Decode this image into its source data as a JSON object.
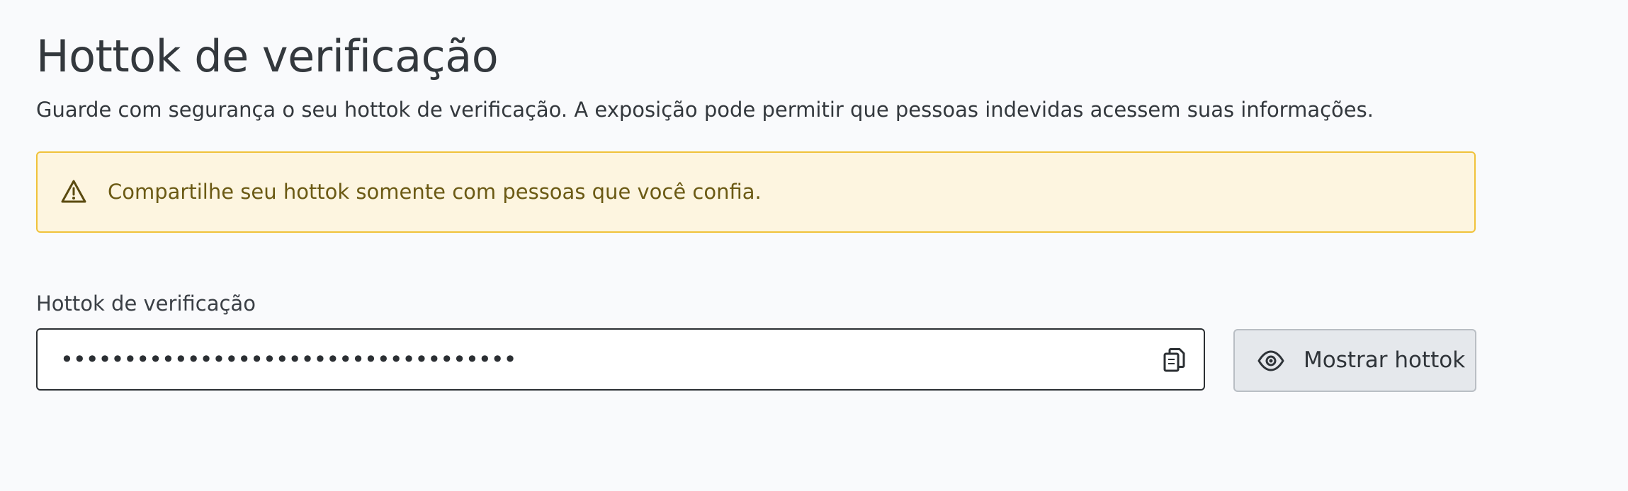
{
  "page": {
    "title": "Hottok de verificação",
    "description": "Guarde com segurança o seu hottok de verificação. A exposição pode permitir que pessoas indevidas acessem suas informações."
  },
  "alert": {
    "icon": "warning-triangle-icon",
    "text": "Compartilhe seu hottok somente com pessoas que você confia.",
    "background_color": "#fdf5e0",
    "border_color": "#f0c23a",
    "text_color": "#6b5a14"
  },
  "hottok_field": {
    "label": "Hottok de verificação",
    "value": "••••••••••••••••••••••••••••••••••••",
    "copy_icon": "copy-icon"
  },
  "show_button": {
    "icon": "eye-icon",
    "label": "Mostrar hottok"
  }
}
